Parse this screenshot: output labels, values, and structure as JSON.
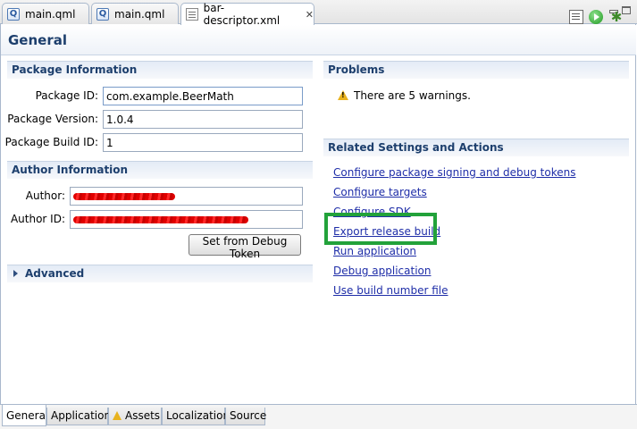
{
  "editor_tabs": [
    {
      "label": "main.qml",
      "icon": "qml-file-icon"
    },
    {
      "label": "main.qml",
      "icon": "qml-file-icon"
    },
    {
      "label": "bar-descriptor.xml",
      "icon": "xml-file-icon",
      "close": "✕"
    }
  ],
  "header": {
    "title": "General"
  },
  "package_info": {
    "title": "Package Information",
    "fields": [
      {
        "label": "Package ID:",
        "value": "com.example.BeerMath"
      },
      {
        "label": "Package Version:",
        "value": "1.0.4"
      },
      {
        "label": "Package Build ID:",
        "value": "1"
      }
    ]
  },
  "author_info": {
    "title": "Author Information",
    "author_label": "Author:",
    "author_id_label": "Author ID:",
    "debug_token_button": "Set from Debug Token"
  },
  "advanced": {
    "title": "Advanced"
  },
  "problems": {
    "title": "Problems",
    "warning_text": "There are 5 warnings."
  },
  "related": {
    "title": "Related Settings and Actions",
    "links": [
      "Configure package signing and debug tokens",
      "Configure targets",
      "Configure SDK",
      "Export release build",
      "Run application",
      "Debug application",
      "Use build number file"
    ]
  },
  "bottom_tabs": [
    "General",
    "Application",
    "Assets",
    "Localization",
    "Source"
  ],
  "colors": {
    "section_title": "#1d3f6d",
    "link": "#1f2ea8",
    "highlight": "#22a23a",
    "warning": "#e8b21e"
  }
}
